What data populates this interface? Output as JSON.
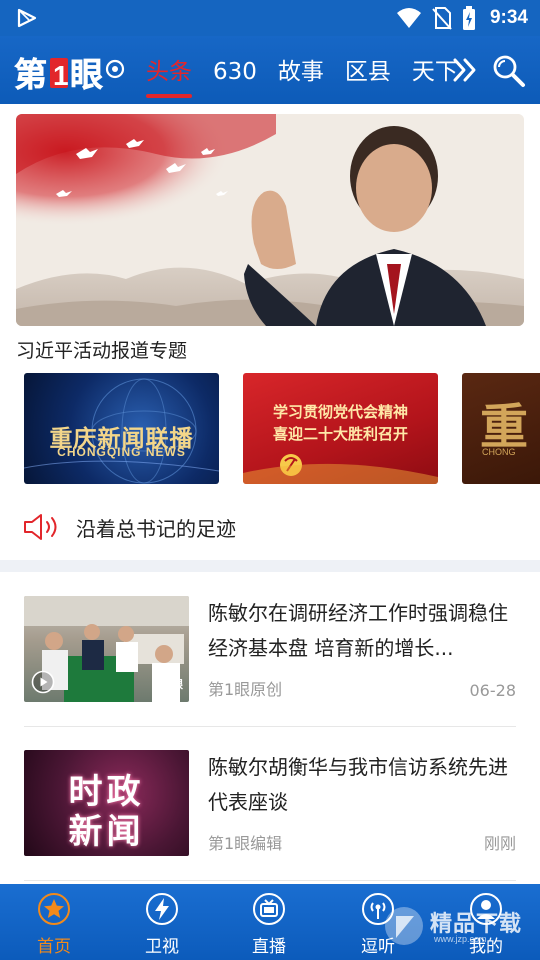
{
  "status_bar": {
    "time": "9:34"
  },
  "header": {
    "logo_text": "第1眼",
    "tabs": [
      {
        "label": "头条",
        "active": true
      },
      {
        "label": "630"
      },
      {
        "label": "故事"
      },
      {
        "label": "区县"
      },
      {
        "label": "天下"
      }
    ]
  },
  "banner": {
    "caption": "习近平活动报道专题"
  },
  "topics": [
    {
      "title": "重庆新闻联播",
      "subtitle": "CHONGQING NEWS"
    },
    {
      "line1": "学习贯彻党代会精神",
      "line2": "喜迎二十大胜利召开"
    },
    {
      "title": "CHONG"
    }
  ],
  "notice": {
    "text": "沿着总书记的足迹"
  },
  "news": [
    {
      "title": "陈敏尔在调研经济工作时强调稳住经济基本盘 培育新的增长...",
      "source": "第1眼原创",
      "time": "06-28",
      "thumb_tag": "第1眼"
    },
    {
      "title": "陈敏尔胡衡华与我市信访系统先进代表座谈",
      "source": "第1眼编辑",
      "time": "刚刚",
      "thumb_text_line1": "时政",
      "thumb_text_line2": "新闻"
    }
  ],
  "bottom_nav": [
    {
      "label": "首页",
      "icon": "star-icon",
      "active": true
    },
    {
      "label": "卫视",
      "icon": "lightning-icon"
    },
    {
      "label": "直播",
      "icon": "tv-icon"
    },
    {
      "label": "逗听",
      "icon": "radio-icon"
    },
    {
      "label": "我的",
      "icon": "user-icon"
    }
  ],
  "watermark": {
    "text": "精品下载",
    "url": "www.jzp.com"
  },
  "colors": {
    "brand_blue": "#1565c0",
    "active_red": "#e2262b",
    "active_orange": "#f28a1b"
  }
}
